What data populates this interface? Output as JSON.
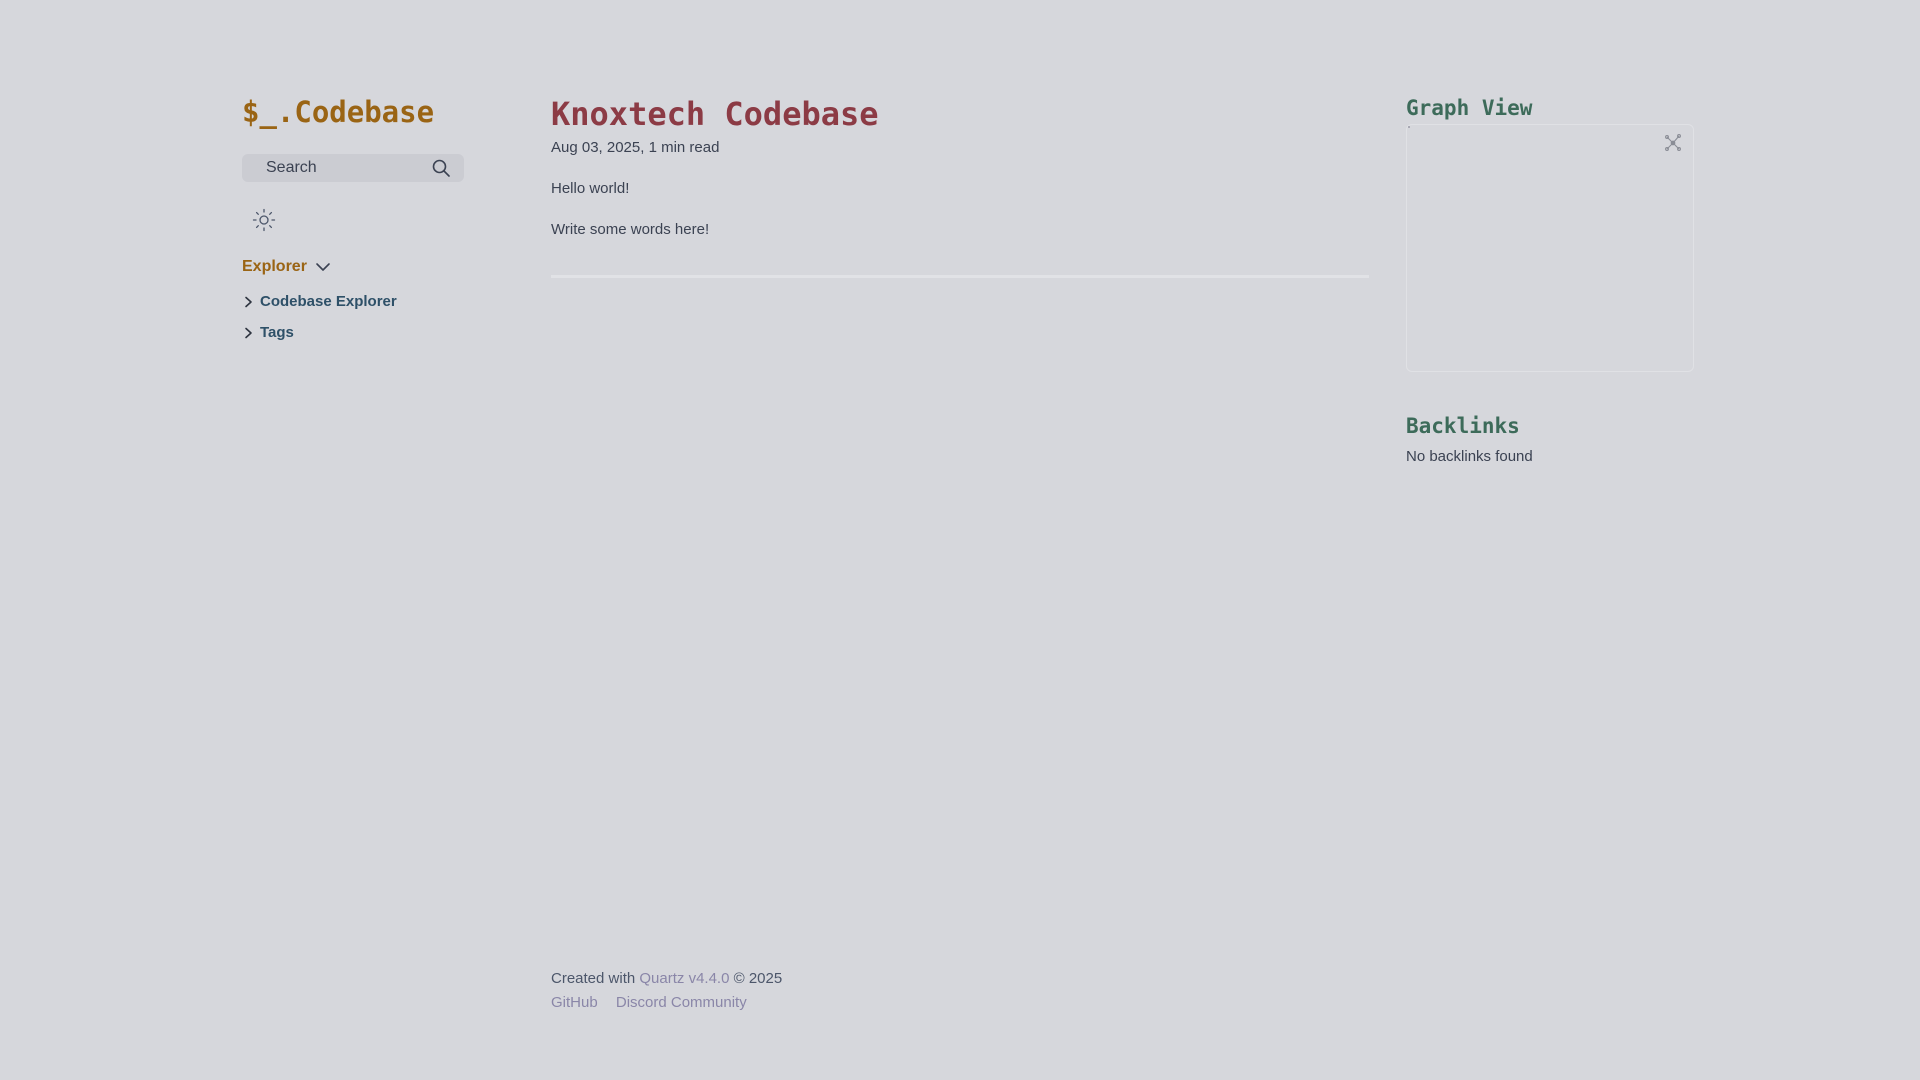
{
  "sidebar": {
    "site_title": "$_.Codebase",
    "search": {
      "label": "Search"
    },
    "explorer": {
      "label": "Explorer",
      "items": [
        {
          "label": "Codebase Explorer"
        },
        {
          "label": "Tags"
        }
      ]
    }
  },
  "article": {
    "title": "Knoxtech Codebase",
    "meta": "Aug 03, 2025,  1 min read",
    "paragraphs": [
      "Hello world!",
      "Write some words here!"
    ]
  },
  "graph": {
    "title": "Graph View"
  },
  "backlinks": {
    "title": "Backlinks",
    "empty_text": "No backlinks found"
  },
  "footer": {
    "created_prefix": "Created with",
    "quartz_link": "Quartz v4.4.0",
    "copyright": "© 2025",
    "links": [
      "GitHub",
      "Discord Community"
    ]
  },
  "colors": {
    "background": "#d6d7dc",
    "site_title": "#9a6414",
    "article_title": "#8c3b45",
    "section_title": "#3d6b5a",
    "explorer_item": "#2e5068",
    "footer_link": "#8a86a8"
  },
  "icons": [
    "search-icon",
    "sun-icon",
    "chevron-down-icon",
    "chevron-right-icon",
    "global-graph-icon"
  ]
}
